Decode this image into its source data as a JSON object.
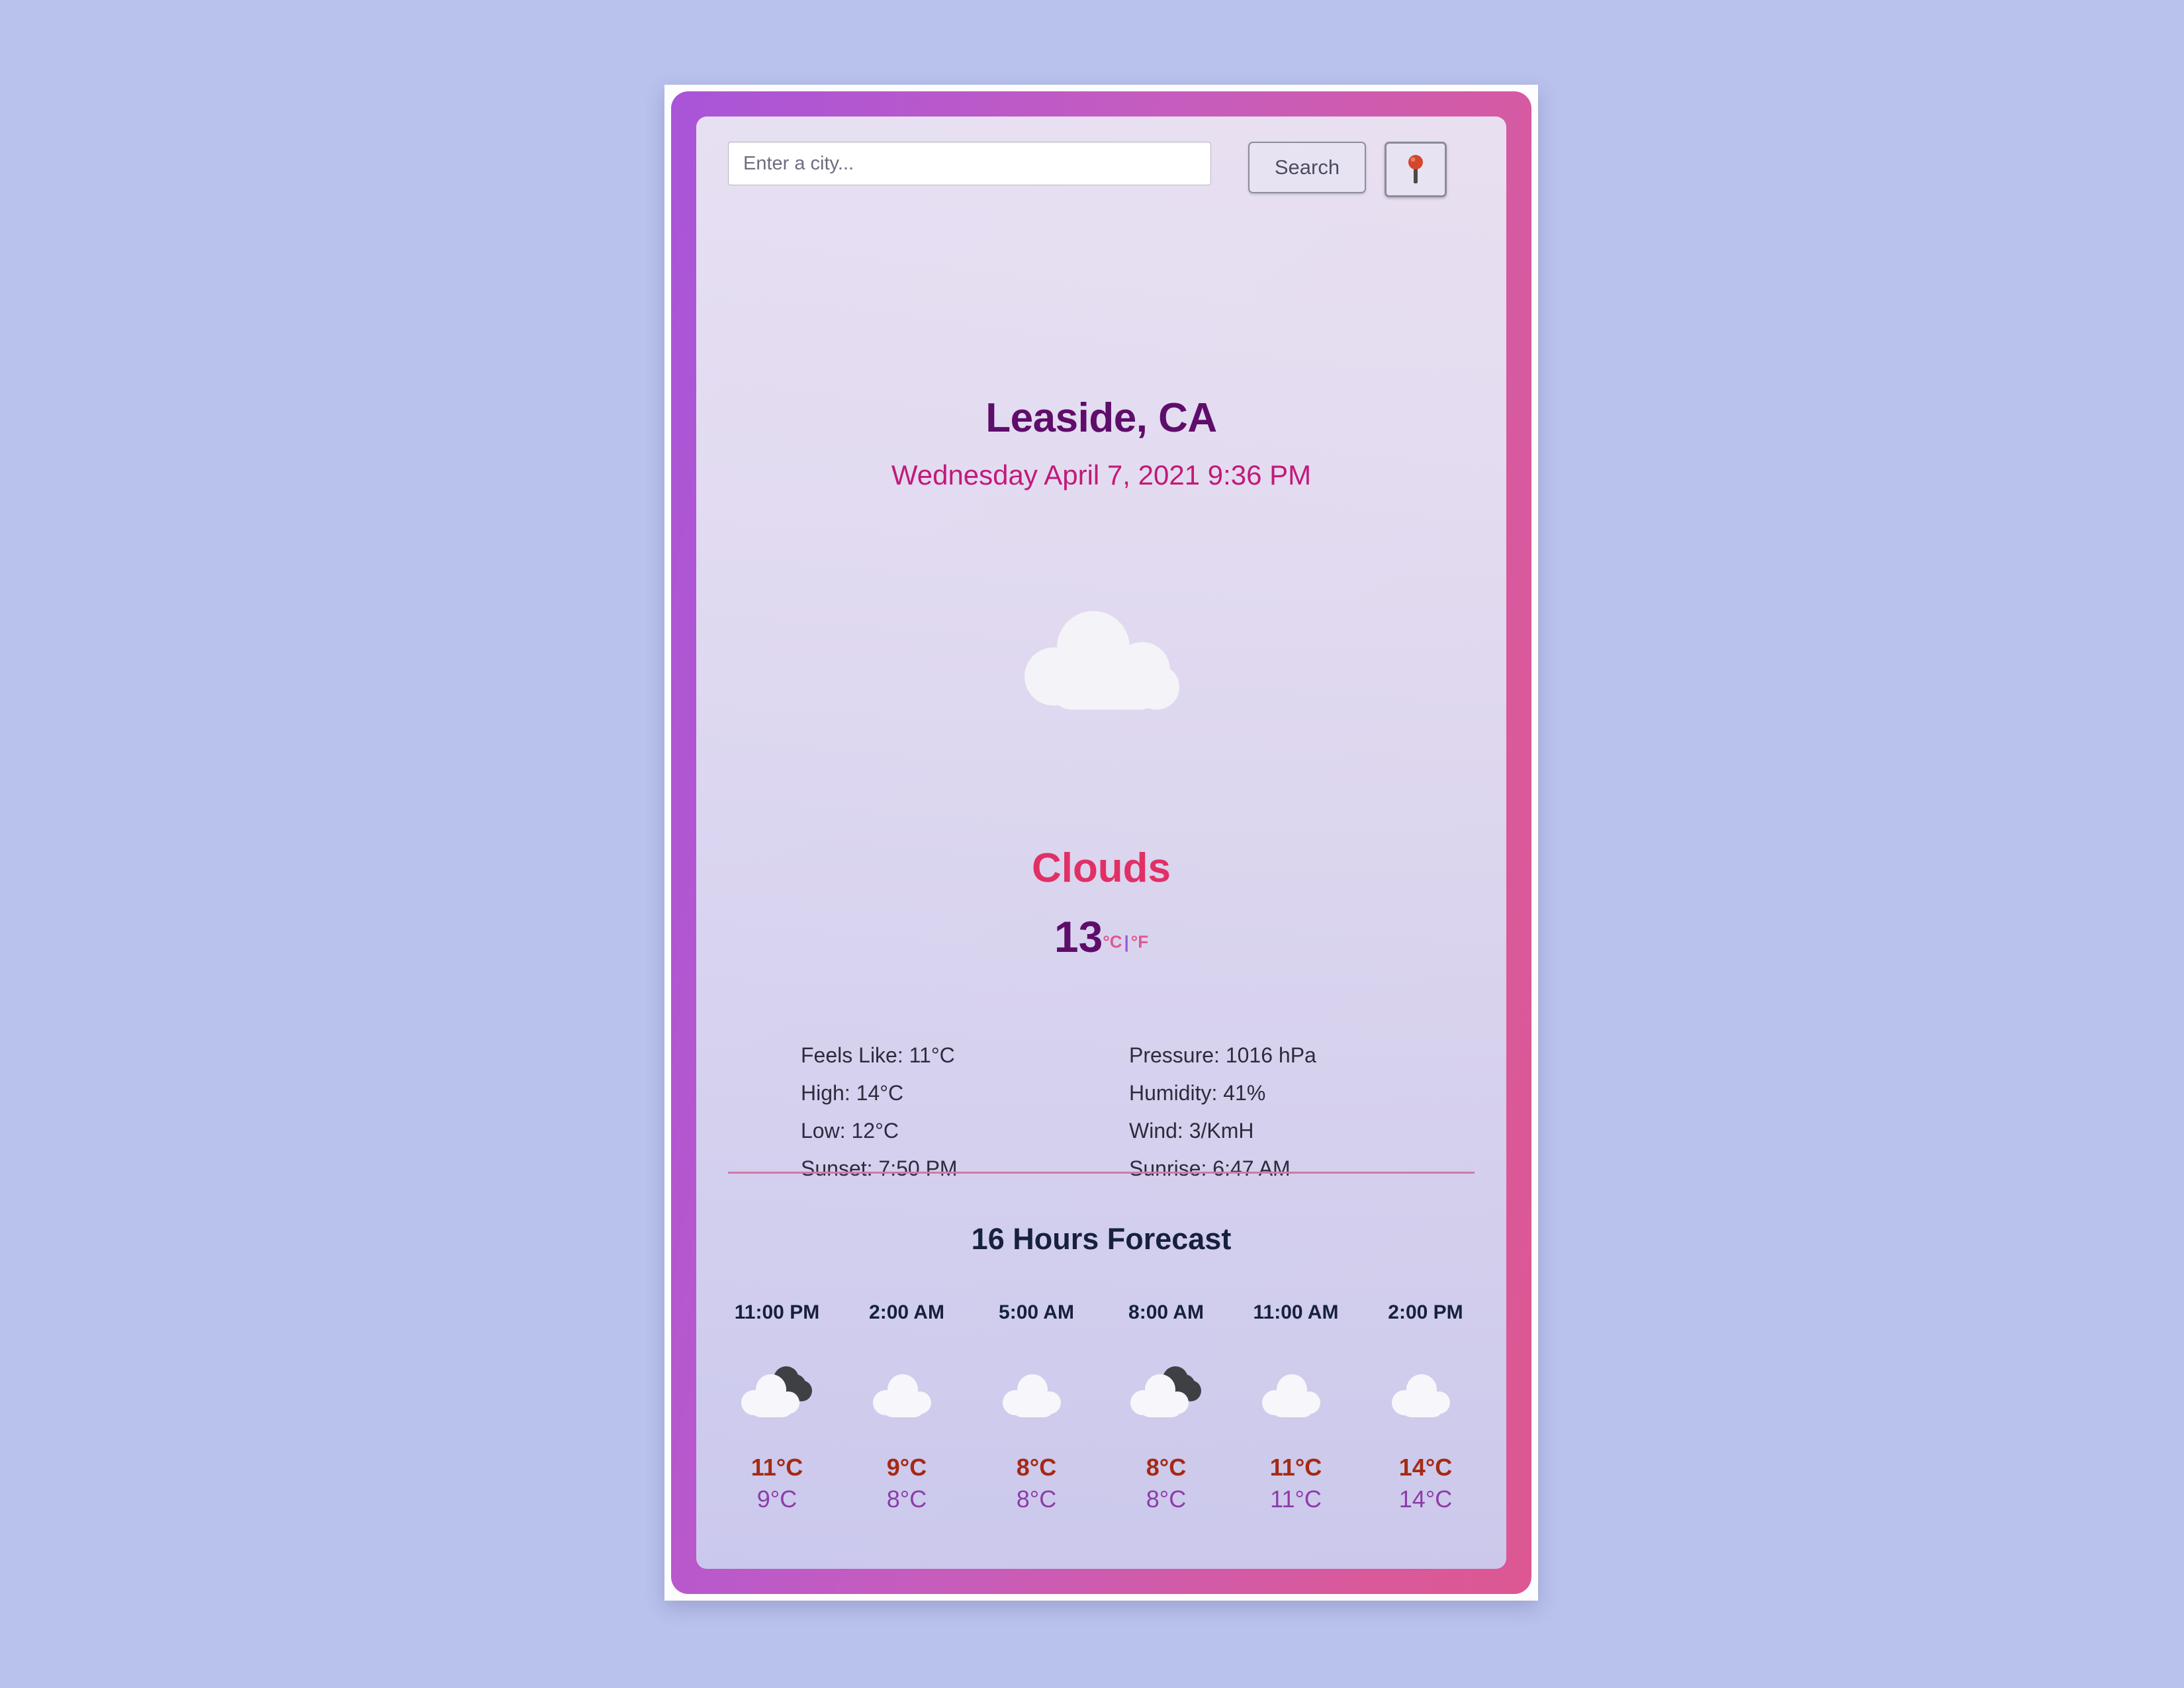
{
  "page": {
    "background_color": "#b8c2ec",
    "card_gradient_start": "#a855d8",
    "card_gradient_end": "#dd5892"
  },
  "search": {
    "placeholder": "Enter a city...",
    "value": "",
    "search_label": "Search",
    "geo_icon": "round-pushpin-icon"
  },
  "current": {
    "location": "Leaside, CA",
    "datetime": "Wednesday April 7, 2021 9:36 PM",
    "icon": "cloud-icon",
    "condition": "Clouds",
    "temperature": "13",
    "unit_celsius": "°C",
    "unit_separator": "|",
    "unit_fahrenheit": "°F"
  },
  "details": {
    "left": [
      "Feels Like: 11°C",
      "High: 14°C",
      "Low: 12°C",
      "Sunset: 7:50 PM"
    ],
    "right": [
      "Pressure: 1016 hPa",
      "Humidity: 41%",
      "Wind: 3/KmH",
      "Sunrise: 6:47 AM"
    ]
  },
  "forecast": {
    "title": "16 Hours Forecast",
    "items": [
      {
        "time": "11:00 PM",
        "icon": "broken-clouds-icon",
        "high": "11°C",
        "low": "9°C"
      },
      {
        "time": "2:00 AM",
        "icon": "cloud-icon",
        "high": "9°C",
        "low": "8°C"
      },
      {
        "time": "5:00 AM",
        "icon": "cloud-icon",
        "high": "8°C",
        "low": "8°C"
      },
      {
        "time": "8:00 AM",
        "icon": "broken-clouds-icon",
        "high": "8°C",
        "low": "8°C"
      },
      {
        "time": "11:00 AM",
        "icon": "cloud-icon",
        "high": "11°C",
        "low": "11°C"
      },
      {
        "time": "2:00 PM",
        "icon": "cloud-icon",
        "high": "14°C",
        "low": "14°C"
      }
    ]
  }
}
